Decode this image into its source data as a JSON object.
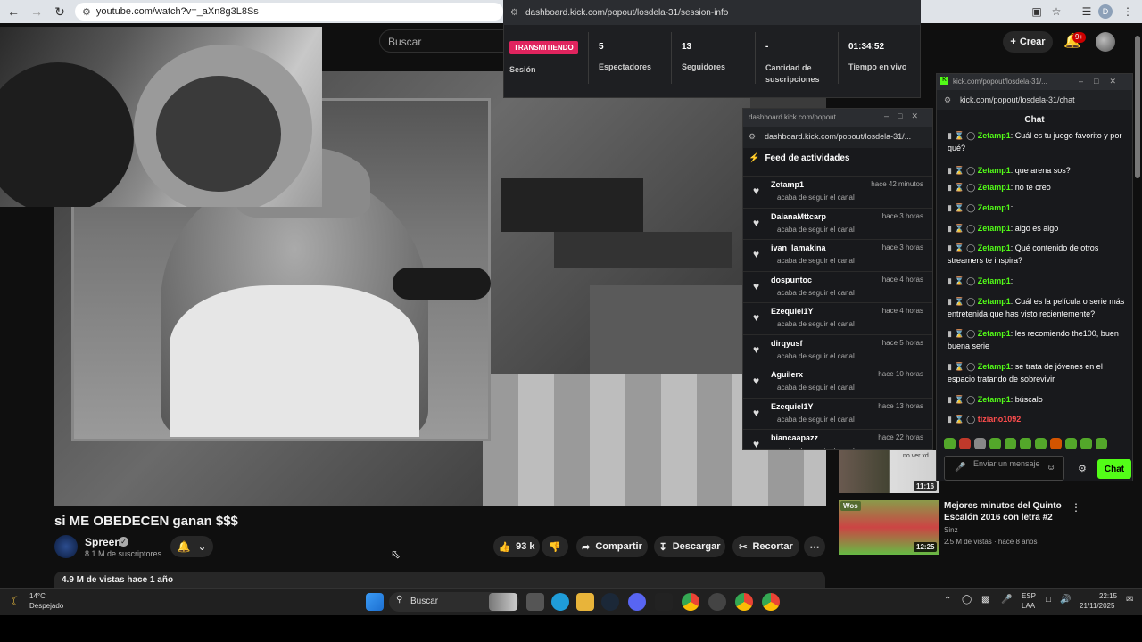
{
  "browser": {
    "url": "youtube.com/watch?v=_aXn8g3L8Ss",
    "profile_initial": "D"
  },
  "youtube": {
    "search_placeholder": "Buscar",
    "create_label": "Crear",
    "notif_badge": "9+",
    "video_title": "si ME OBEDECEN ganan $$$",
    "channel_name": "Spreen",
    "channel_subs": "8.1 M de suscriptores",
    "likes": "93 k",
    "share_label": "Compartir",
    "download_label": "Descargar",
    "clip_label": "Recortar",
    "views_line": "4.9 M de vistas  hace 1 año",
    "recommendations": [
      {
        "title": "",
        "duration": "11:16",
        "overlay": "no ver xd"
      },
      {
        "title": "Mejores minutos del Quinto Escalón 2016 con letra #2",
        "channel": "Sinz",
        "meta": "2.5 M de vistas · hace 8 años",
        "duration": "12:25",
        "badge": "Wos"
      }
    ]
  },
  "session": {
    "url": "dashboard.kick.com/popout/losdela-31/session-info",
    "live_badge": "TRANSMITIENDO",
    "session_label": "Sesión",
    "stats": [
      {
        "value": "5",
        "label": "Espectadores"
      },
      {
        "value": "13",
        "label": "Seguidores"
      },
      {
        "value": "-",
        "label": "Cantidad de suscripciones"
      },
      {
        "value": "01:34:52",
        "label": "Tiempo en vivo"
      }
    ]
  },
  "feed": {
    "window_title": "dashboard.kick.com/popout...",
    "url": "dashboard.kick.com/popout/losdela-31/...",
    "heading": "Feed de actividades",
    "subtext": "acaba de seguir el canal",
    "items": [
      {
        "name": "Zetamp1",
        "time": "hace 42 minutos"
      },
      {
        "name": "DaianaMttcarp",
        "time": "hace 3 horas"
      },
      {
        "name": "ivan_lamakina",
        "time": "hace 3 horas"
      },
      {
        "name": "dospuntoc",
        "time": "hace 4 horas"
      },
      {
        "name": "Ezequiel1Y",
        "time": "hace 4 horas"
      },
      {
        "name": "dirqyusf",
        "time": "hace 5 horas"
      },
      {
        "name": "Aguilerx",
        "time": "hace 10 horas"
      },
      {
        "name": "Ezequiel1Y",
        "time": "hace 13 horas"
      },
      {
        "name": "biancaapazz",
        "time": "hace 22 horas"
      }
    ]
  },
  "chat": {
    "window_title": "kick.com/popout/losdela-31/...",
    "url": "kick.com/popout/losdela-31/chat",
    "heading": "Chat",
    "messages": [
      {
        "user": "Zetamp1",
        "text": ": Cuál es tu juego favorito y por qué?"
      },
      {
        "user": "Zetamp1",
        "text": ": que arena sos?"
      },
      {
        "user": "Zetamp1",
        "text": ": no te creo"
      },
      {
        "user": "Zetamp1",
        "text": ":"
      },
      {
        "user": "Zetamp1",
        "text": ": algo es algo"
      },
      {
        "user": "Zetamp1",
        "text": ": Qué contenido de otros streamers te inspira?"
      },
      {
        "user": "Zetamp1",
        "text": ":"
      },
      {
        "user": "Zetamp1",
        "text": ": Cuál es la película o serie más entretenida que has visto recientemente?"
      },
      {
        "user": "Zetamp1",
        "text": ": les recomiendo the100, buen buena serie"
      },
      {
        "user": "Zetamp1",
        "text": ": se trata de jóvenes en el espacio tratando de sobrevivir"
      },
      {
        "user": "Zetamp1",
        "text": ": búscalo"
      },
      {
        "user": "tiziano1092",
        "text": ":"
      }
    ],
    "input_placeholder": "Enviar un mensaje",
    "send_label": "Chat"
  },
  "taskbar": {
    "weather_temp": "14°C",
    "weather_desc": "Despejado",
    "search_label": "Buscar",
    "lang_top": "ESP",
    "lang_bottom": "LAA",
    "time": "22:15",
    "date": "21/11/2025"
  }
}
